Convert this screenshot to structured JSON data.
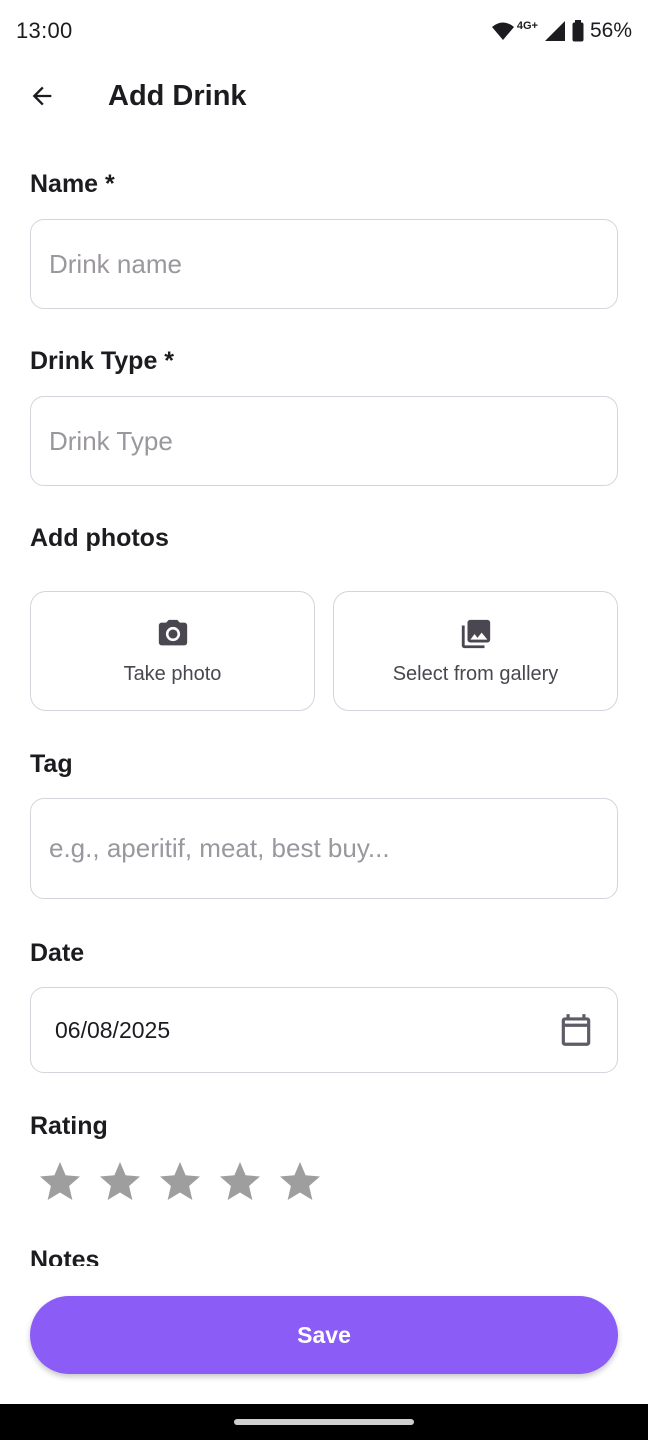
{
  "status_bar": {
    "time": "13:00",
    "network": "4G+",
    "battery": "56%"
  },
  "app_bar": {
    "title": "Add Drink"
  },
  "form": {
    "name": {
      "label": "Name *",
      "placeholder": "Drink name"
    },
    "drink_type": {
      "label": "Drink Type *",
      "placeholder": "Drink Type"
    },
    "photos": {
      "label": "Add photos",
      "take_photo": "Take photo",
      "gallery": "Select from gallery"
    },
    "tag": {
      "label": "Tag",
      "placeholder": "e.g., aperitif, meat, best buy..."
    },
    "date": {
      "label": "Date",
      "value": "06/08/2025"
    },
    "rating": {
      "label": "Rating",
      "value": 0,
      "max": 5
    },
    "notes": {
      "label": "Notes"
    }
  },
  "save_label": "Save",
  "colors": {
    "accent": "#8b5cf6",
    "star_inactive": "#9e9e9e",
    "border": "#d6d3dc"
  }
}
